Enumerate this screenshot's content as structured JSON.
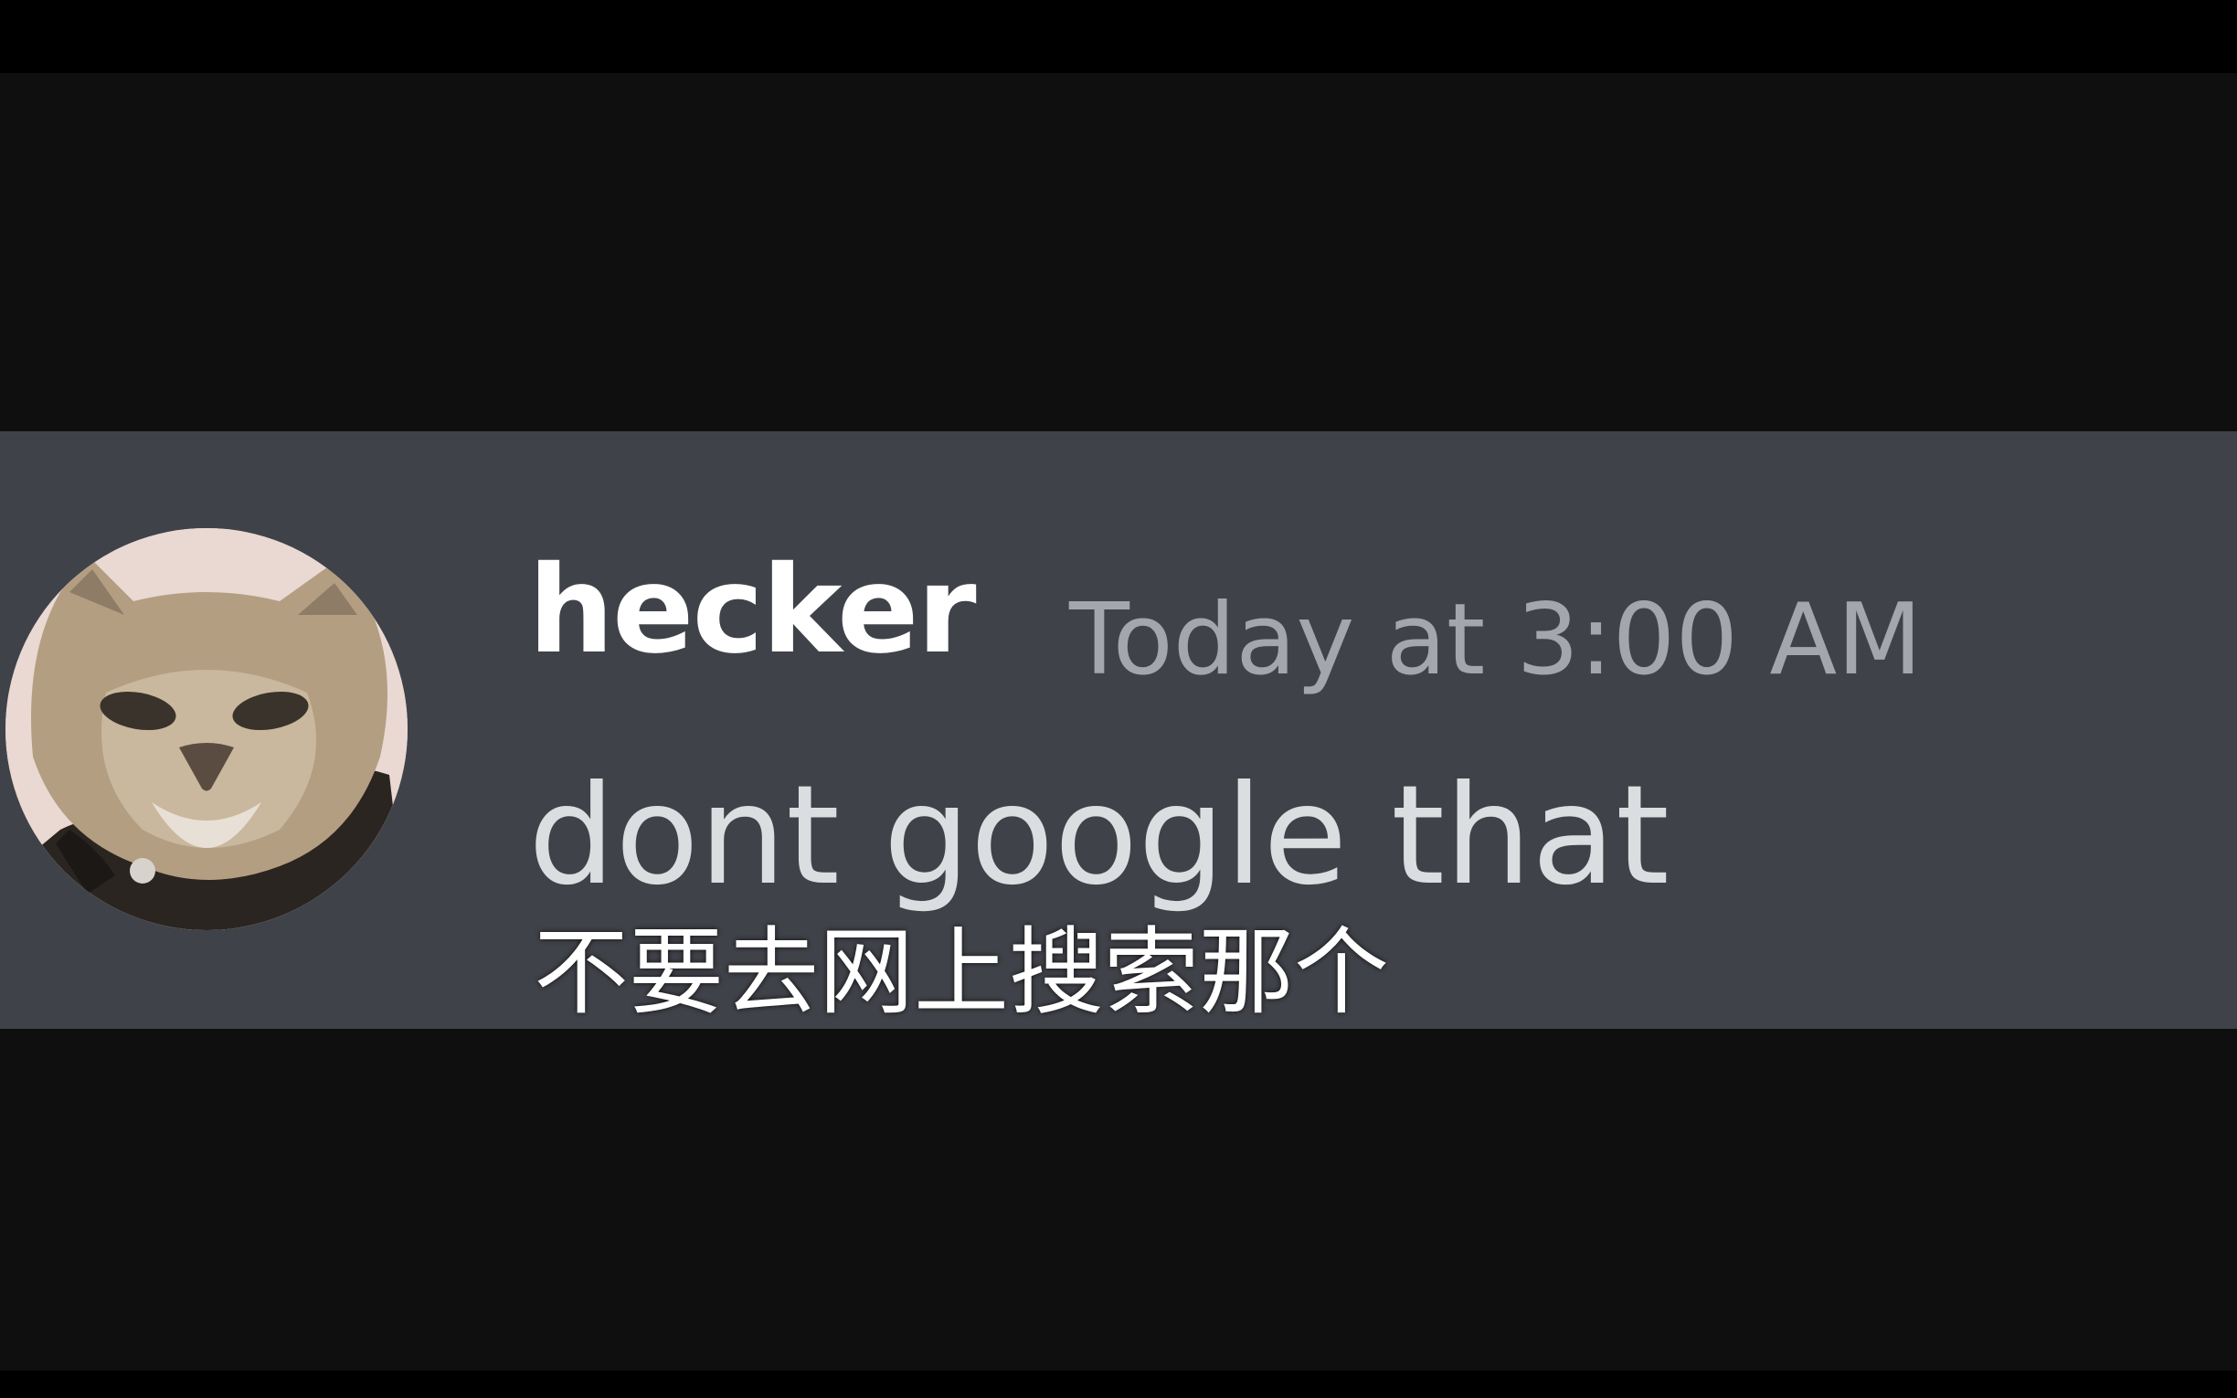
{
  "message": {
    "username": "hecker",
    "timestamp": "Today at 3:00 AM",
    "text": "dont google that",
    "avatar_icon": "cat-avatar-icon"
  },
  "subtitle": {
    "text": "不要去网上搜索那个"
  },
  "colors": {
    "background": "#0f0f10",
    "message_highlight": "#404249",
    "username": "#ffffff",
    "timestamp": "#a3a6ad",
    "message_text": "#dbdee1"
  }
}
